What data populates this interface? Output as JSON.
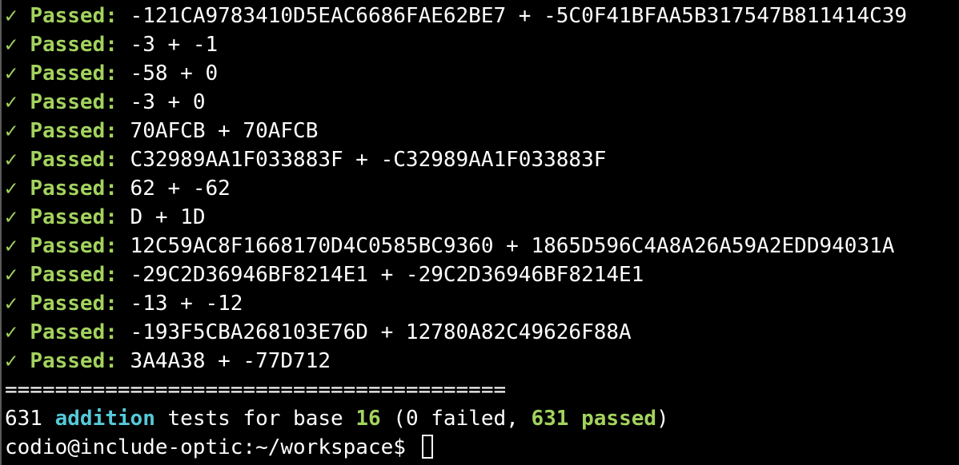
{
  "results": [
    {
      "check": "✓",
      "label": "Passed:",
      "expr": "-121CA9783410D5EAC6686FAE62BE7 + -5C0F41BFAA5B317547B811414C39"
    },
    {
      "check": "✓",
      "label": "Passed:",
      "expr": "-3 + -1"
    },
    {
      "check": "✓",
      "label": "Passed:",
      "expr": "-58 + 0"
    },
    {
      "check": "✓",
      "label": "Passed:",
      "expr": "-3 + 0"
    },
    {
      "check": "✓",
      "label": "Passed:",
      "expr": "70AFCB + 70AFCB"
    },
    {
      "check": "✓",
      "label": "Passed:",
      "expr": "C32989AA1F033883F + -C32989AA1F033883F"
    },
    {
      "check": "✓",
      "label": "Passed:",
      "expr": "62 + -62"
    },
    {
      "check": "✓",
      "label": "Passed:",
      "expr": "D + 1D"
    },
    {
      "check": "✓",
      "label": "Passed:",
      "expr": "12C59AC8F1668170D4C0585BC9360 + 1865D596C4A8A26A59A2EDD94031A"
    },
    {
      "check": "✓",
      "label": "Passed:",
      "expr": "-29C2D36946BF8214E1 + -29C2D36946BF8214E1"
    },
    {
      "check": "✓",
      "label": "Passed:",
      "expr": "-13 + -12"
    },
    {
      "check": "✓",
      "label": "Passed:",
      "expr": "-193F5CBA268103E76D + 12780A82C49626F88A"
    },
    {
      "check": "✓",
      "label": "Passed:",
      "expr": "3A4A38 + -77D712"
    }
  ],
  "separator": "========================================",
  "summary": {
    "count": "631",
    "operation": "addition",
    "tests_for_base": "tests for base",
    "base": "16",
    "open_paren": "(0 failed,",
    "passed_count": "631 passed",
    "close_paren": ")"
  },
  "prompt": {
    "text": "codio@include-optic:~/workspace$"
  },
  "colors": {
    "background": "#000000",
    "passed": "#a3d35e",
    "cyan": "#56c8d8",
    "text": "#ffffff"
  }
}
